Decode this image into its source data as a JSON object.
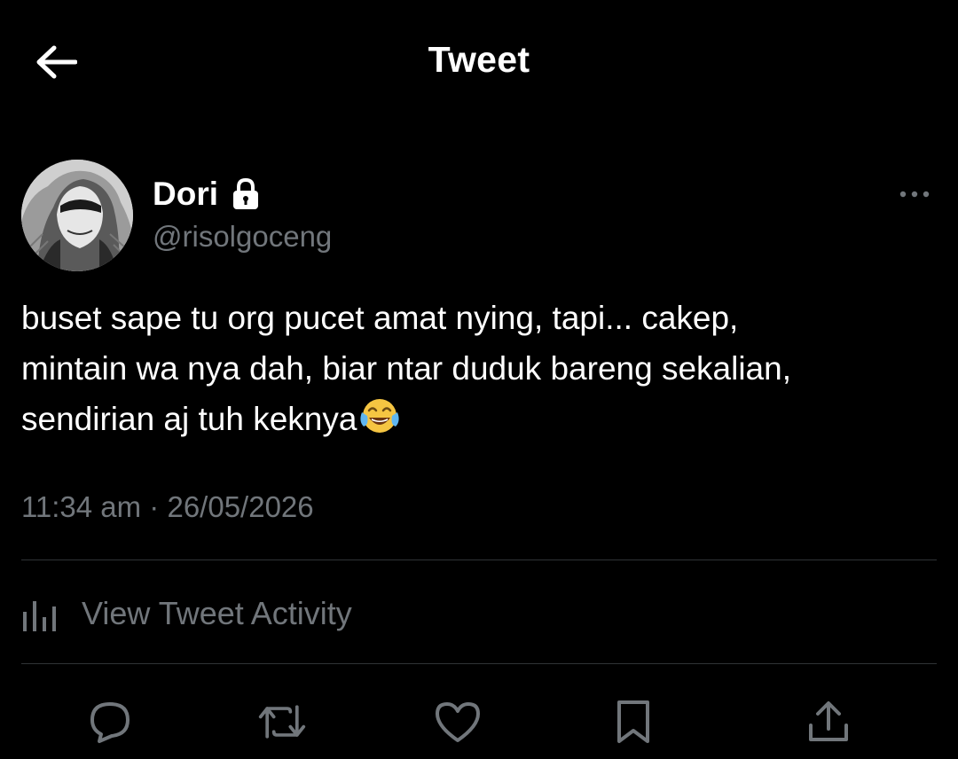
{
  "header": {
    "back_icon": "arrow-left-icon",
    "title": "Tweet"
  },
  "author": {
    "display_name": "Dori",
    "protected_icon": "lock-icon",
    "handle": "@risolgoceng",
    "more_icon": "more-horizontal-icon"
  },
  "tweet": {
    "lines": [
      "buset sape tu org pucet amat nying, tapi... cakep,",
      "mintain wa nya dah, biar ntar duduk bareng sekalian,",
      "sendirian aj tuh keknya"
    ],
    "emoji": "face-with-tears-of-joy",
    "timestamp": "11:34 am · 26/05/2026"
  },
  "activity": {
    "icon": "analytics-icon",
    "label": "View Tweet Activity"
  },
  "actions": [
    {
      "name": "reply",
      "icon": "reply-icon"
    },
    {
      "name": "retweet",
      "icon": "retweet-icon"
    },
    {
      "name": "like",
      "icon": "like-icon"
    },
    {
      "name": "bookmark",
      "icon": "bookmark-icon"
    },
    {
      "name": "share",
      "icon": "share-icon"
    }
  ],
  "colors": {
    "background": "#000000",
    "primary_text": "#ffffff",
    "secondary_text": "#71767b",
    "divider": "#2f3336"
  }
}
